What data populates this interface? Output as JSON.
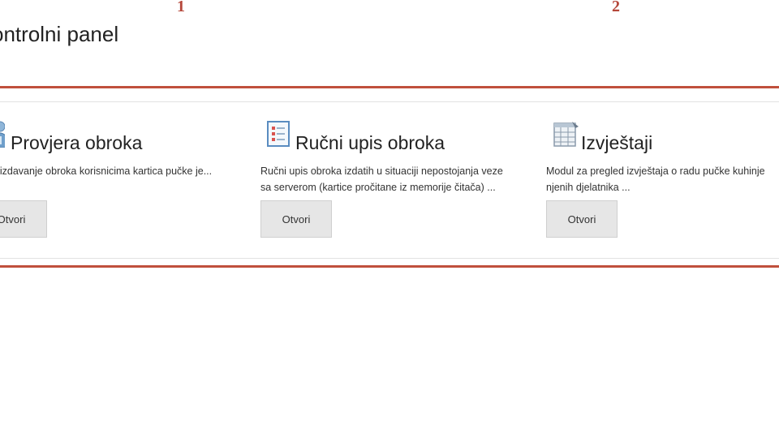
{
  "annotations": {
    "first": "1",
    "second": "2",
    "color": "#b5473a"
  },
  "header": {
    "title": "ontrolni panel"
  },
  "theme": {
    "frame_color": "#c0503c",
    "button_bg": "#e6e6e6"
  },
  "modules": [
    {
      "title": "Provjera obroka",
      "icon": "person-check-icon",
      "description": "ul za izdavanje obroka korisnicima kartica pučke je...",
      "button_label": "Otvori"
    },
    {
      "title": "Ručni upis obroka",
      "icon": "manual-entry-form-icon",
      "description": "Ručni upis obroka izdatih u situaciji nepostojanja veze sa serverom (kartice pročitane iz memorije čitača) ...",
      "button_label": "Otvori"
    },
    {
      "title": "Izvještaji",
      "icon": "report-table-icon",
      "description": "Modul za pregled izvještaja o radu pučke kuhinje njenih djelatnika ...",
      "button_label": "Otvori"
    }
  ]
}
